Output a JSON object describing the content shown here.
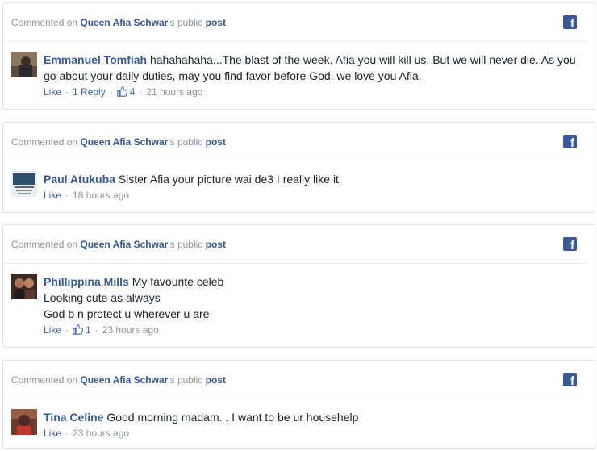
{
  "colors": {
    "link": "#365899",
    "muted": "#90949c",
    "facebook_blue": "#3b5998",
    "border": "#dddfe2"
  },
  "cards": [
    {
      "header": {
        "prefix": "Commented on ",
        "page_name": "Queen Afia Schwar",
        "possessive": "'s public ",
        "post_link": "post"
      },
      "comment": {
        "author": "Emmanuel Tomfiah",
        "text": "hahahahaha...The blast of the week. Afia you will kill us. But we will never die. As you go about your daily duties, may you find favor before God. we love you Afia.",
        "like_label": "Like",
        "reply_label": "1 Reply",
        "reaction_count": "4",
        "time": "21 hours ago"
      }
    },
    {
      "header": {
        "prefix": "Commented on ",
        "page_name": "Queen Afia Schwar",
        "possessive": "'s public ",
        "post_link": "post"
      },
      "comment": {
        "author": "Paul Atukuba",
        "text": "Sister Afia your picture wai de3 I really like it",
        "like_label": "Like",
        "time": "18 hours ago"
      }
    },
    {
      "header": {
        "prefix": "Commented on ",
        "page_name": "Queen Afia Schwar",
        "possessive": "'s public ",
        "post_link": "post"
      },
      "comment": {
        "author": "Phillippina Mills",
        "text_lines": [
          "My favourite celeb",
          "Looking cute as always",
          "God b n protect u wherever u are"
        ],
        "like_label": "Like",
        "reaction_count": "1",
        "time": "23 hours ago"
      }
    },
    {
      "header": {
        "prefix": "Commented on ",
        "page_name": "Queen Afia Schwar",
        "possessive": "'s public ",
        "post_link": "post"
      },
      "comment": {
        "author": "Tina Celine",
        "text": "Good morning madam. . I want to be ur househelp",
        "like_label": "Like",
        "time": "23 hours ago"
      }
    }
  ],
  "icons": {
    "platform": "facebook-icon",
    "reaction": "thumbs-up-icon"
  }
}
